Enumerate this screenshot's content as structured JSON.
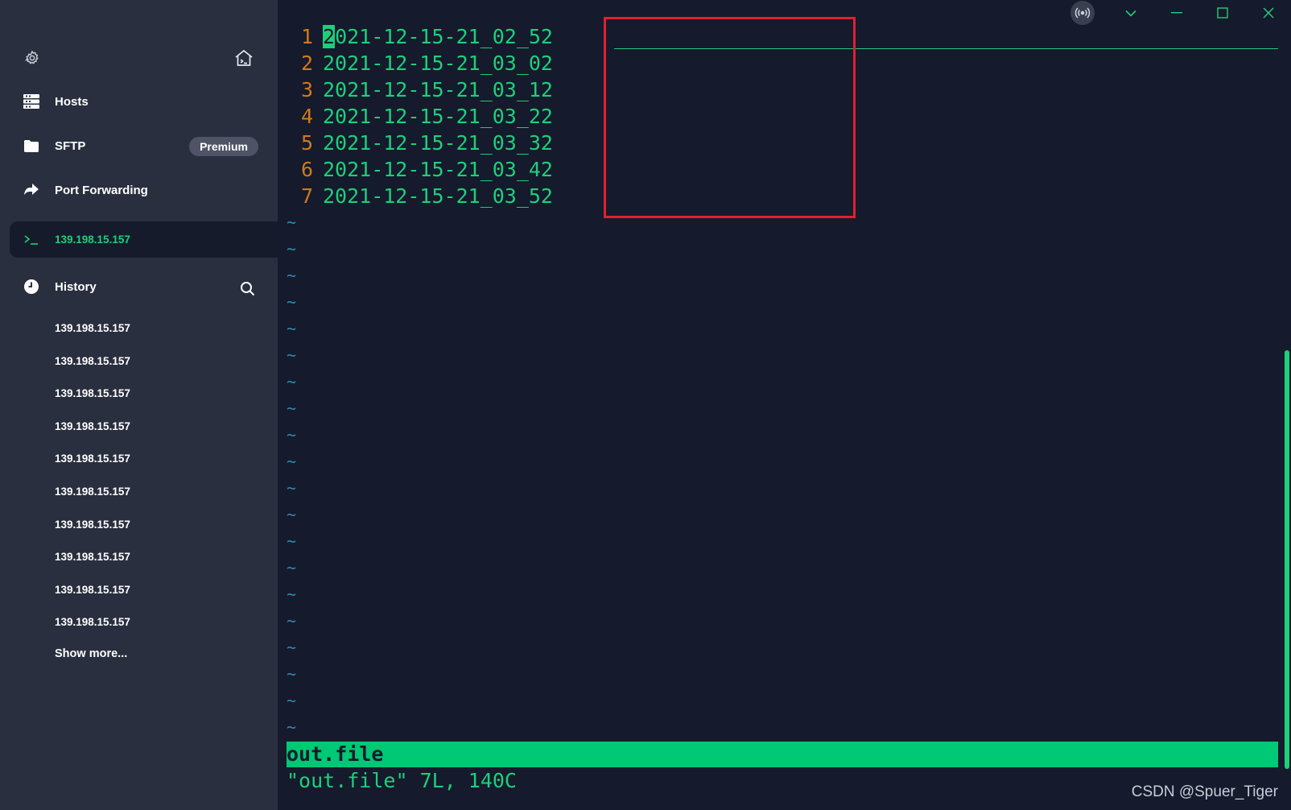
{
  "sidebar": {
    "nav": {
      "hosts": "Hosts",
      "sftp": "SFTP",
      "sftp_badge": "Premium",
      "port_forwarding": "Port Forwarding",
      "active_session": "139.198.15.157",
      "history": "History"
    },
    "history_items": [
      "139.198.15.157",
      "139.198.15.157",
      "139.198.15.157",
      "139.198.15.157",
      "139.198.15.157",
      "139.198.15.157",
      "139.198.15.157",
      "139.198.15.157",
      "139.198.15.157",
      "139.198.15.157"
    ],
    "show_more": "Show more..."
  },
  "terminal": {
    "lines": [
      {
        "num": "1",
        "first_char": "2",
        "rest": "021-12-15-21_02_52"
      },
      {
        "num": "2",
        "text": "2021-12-15-21_03_02"
      },
      {
        "num": "3",
        "text": "2021-12-15-21_03_12"
      },
      {
        "num": "4",
        "text": "2021-12-15-21_03_22"
      },
      {
        "num": "5",
        "text": "2021-12-15-21_03_32"
      },
      {
        "num": "6",
        "text": "2021-12-15-21_03_42"
      },
      {
        "num": "7",
        "text": "2021-12-15-21_03_52"
      }
    ],
    "tilde": "~",
    "tilde_count": 20,
    "statusline": "out.file",
    "message": "\"out.file\" 7L, 140C"
  },
  "watermark": "CSDN @Spuer_Tiger",
  "colors": {
    "accent": "#1ecf7a",
    "line_number": "#d07a1a",
    "tilde": "#2d89b0",
    "highlight_box": "#e02030",
    "sidebar_bg": "#2a2f3f",
    "terminal_bg": "#151a2c"
  },
  "icons": {
    "settings": "gear-icon",
    "home": "home-terminal-icon",
    "hosts": "server-grid-icon",
    "sftp": "folder-icon",
    "port_forwarding": "forward-arrow-icon",
    "session": "terminal-prompt-icon",
    "history": "clock-icon",
    "search": "search-icon",
    "broadcast": "broadcast-icon",
    "dropdown": "chevron-down-icon",
    "minimize": "minimize-icon",
    "maximize": "maximize-icon",
    "close": "close-icon"
  }
}
